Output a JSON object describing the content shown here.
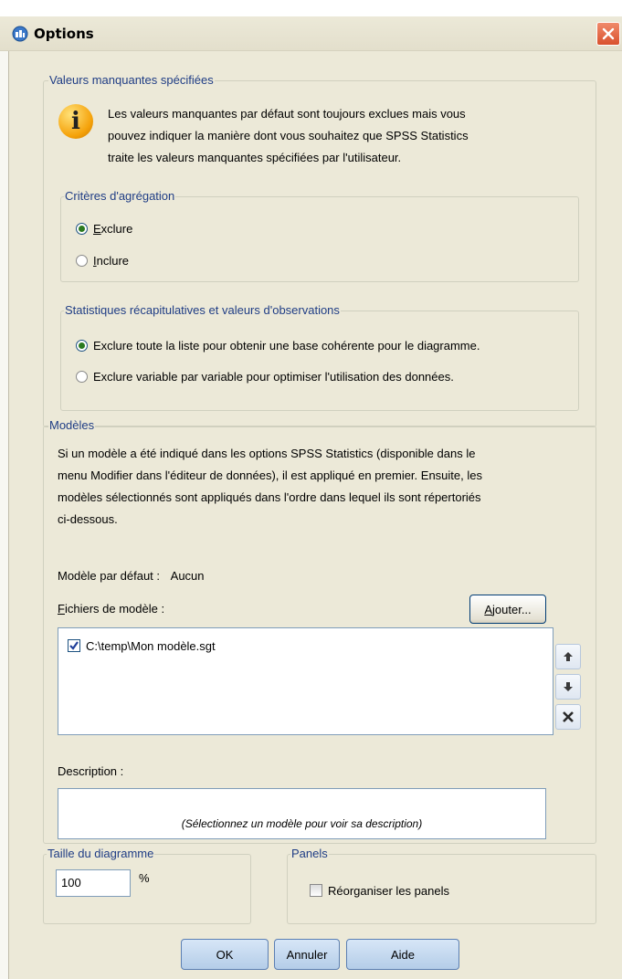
{
  "window": {
    "title": "Options",
    "close_glyph": "✕"
  },
  "missing_values": {
    "legend": "Valeurs manquantes spécifiées",
    "info_text_lines": [
      "Les valeurs manquantes par défaut sont toujours exclues mais vous",
      "pouvez indiquer la manière dont vous souhaitez que SPSS Statistics",
      "traite les valeurs manquantes spécifiées par l'utilisateur."
    ],
    "aggregation": {
      "legend": "Critères d'agrégation",
      "options": [
        {
          "label": "Exclure",
          "selected": true
        },
        {
          "label": "Inclure",
          "selected": false
        }
      ]
    },
    "summary_stats": {
      "legend": "Statistiques récapitulatives et valeurs d'observations",
      "options": [
        {
          "label": "Exclure toute la liste pour obtenir une base cohérente pour le diagramme.",
          "selected": true
        },
        {
          "label": "Exclure variable par variable pour optimiser l'utilisation des données.",
          "selected": false
        }
      ]
    }
  },
  "templates": {
    "legend": "Modèles",
    "description_lines": [
      "Si un modèle a été indiqué dans les options SPSS Statistics (disponible dans le",
      "menu Modifier dans l'éditeur de données), il est appliqué en premier. Ensuite, les",
      "modèles sélectionnés sont appliqués dans l'ordre dans lequel ils sont répertoriés",
      "ci-dessous."
    ],
    "default_template_label": "Modèle par défaut :",
    "default_template_value": "Aucun",
    "files_label": "Fichiers de modèle :",
    "add_button": "Ajouter...",
    "files": [
      {
        "path": "C:\\temp\\Mon modèle.sgt",
        "checked": true
      }
    ],
    "description_label": "Description :",
    "description_placeholder": "(Sélectionnez un modèle pour voir sa description)"
  },
  "chart_size": {
    "legend": "Taille du diagramme",
    "value": "100",
    "unit": "%"
  },
  "panels": {
    "legend": "Panels",
    "wrap_label": "Réorganiser les panels",
    "wrap_checked": false
  },
  "buttons": {
    "ok": "OK",
    "cancel": "Annuler",
    "help": "Aide"
  }
}
